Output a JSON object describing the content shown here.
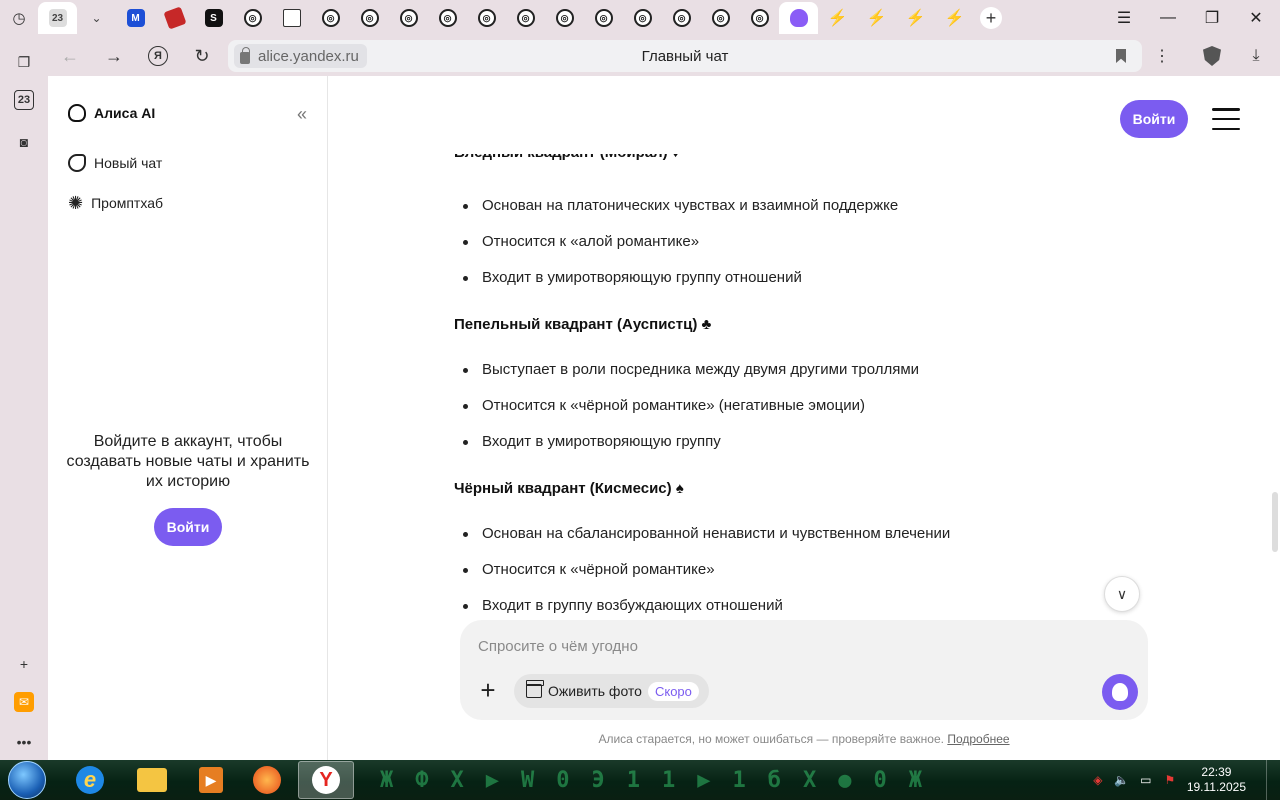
{
  "browser": {
    "tab_counter": "23",
    "tabs": [
      {
        "icon": "tab-counter"
      },
      {
        "icon": "chevron-down-icon"
      },
      {
        "icon": "m-favicon",
        "glyph": "M"
      },
      {
        "icon": "red-favicon",
        "glyph": ""
      },
      {
        "icon": "s-favicon",
        "glyph": "S"
      },
      {
        "icon": "brain-favicon",
        "glyph": "◎"
      },
      {
        "icon": "document-favicon",
        "glyph": ""
      },
      {
        "icon": "brain-favicon",
        "glyph": "◎"
      },
      {
        "icon": "brain-favicon",
        "glyph": "◎"
      },
      {
        "icon": "brain-favicon",
        "glyph": "◎"
      },
      {
        "icon": "brain-favicon",
        "glyph": "◎"
      },
      {
        "icon": "brain-favicon",
        "glyph": "◎"
      },
      {
        "icon": "brain-favicon",
        "glyph": "◎"
      },
      {
        "icon": "brain-favicon",
        "glyph": "◎"
      },
      {
        "icon": "brain-favicon",
        "glyph": "◎"
      },
      {
        "icon": "brain-favicon",
        "glyph": "◎"
      },
      {
        "icon": "brain-favicon",
        "glyph": "◎"
      },
      {
        "icon": "brain-favicon",
        "glyph": "◎"
      },
      {
        "icon": "brain-favicon",
        "glyph": "◎"
      },
      {
        "icon": "alice-favicon",
        "glyph": "",
        "active": true
      },
      {
        "icon": "bolt-favicon",
        "glyph": "⚡"
      },
      {
        "icon": "bolt-favicon",
        "glyph": "⚡"
      },
      {
        "icon": "bolt-favicon",
        "glyph": "⚡"
      },
      {
        "icon": "bolt-favicon",
        "glyph": "⚡"
      }
    ],
    "url": "alice.yandex.ru",
    "page_title": "Главный чат",
    "ya_button": "Я",
    "left_strip_calendar": "23"
  },
  "sidebar": {
    "brand": "Алиса AI",
    "collapse_glyph": "«",
    "items": [
      {
        "label": "Новый чат",
        "icon": "chat-icon"
      },
      {
        "label": "Промптхаб",
        "icon": "sparkle-icon"
      }
    ],
    "login_prompt": "Войдите в аккаунт, чтобы создавать новые чаты и хранить их историю",
    "login_button": "Войти"
  },
  "header": {
    "login_button": "Войти"
  },
  "chat": {
    "partial_heading": "Бледный квадрант (Мойрал) ♦",
    "sections": [
      {
        "heading": "",
        "items": [
          "Основан на платонических чувствах и взаимной поддержке",
          "Относится к «алой романтике»",
          "Входит в умиротворяющую группу отношений"
        ]
      },
      {
        "heading": "Пепельный квадрант (Ауспистц) ♣",
        "items": [
          "Выступает в роли посредника между двумя другими троллями",
          "Относится к «чёрной романтике» (негативные эмоции)",
          "Входит в умиротворяющую группу"
        ]
      },
      {
        "heading": "Чёрный квадрант (Кисмесис) ♠",
        "items": [
          "Основан на сбалансированной ненависти и чувственном влечении",
          "Относится к «чёрной романтике»",
          "Входит в группу возбуждающих отношений"
        ]
      }
    ]
  },
  "composer": {
    "placeholder": "Спросите о чём угодно",
    "photo_chip": "Оживить фото",
    "soon_badge": "Скоро"
  },
  "footer": {
    "disclaimer": "Алиса старается, но может ошибаться — проверяйте важное.",
    "more_link": "Подробнее"
  },
  "taskbar": {
    "time": "22:39",
    "date": "19.11.2025",
    "matrix_glyphs": [
      "Ж",
      "Ф",
      "X",
      "▶",
      "W",
      "0",
      "Э",
      "1",
      "1",
      "▶",
      "1",
      "б",
      "X",
      "●",
      "0",
      "Ж"
    ]
  },
  "colors": {
    "accent": "#7b5cf0",
    "tab_bar_bg": "#e9dfe4"
  }
}
